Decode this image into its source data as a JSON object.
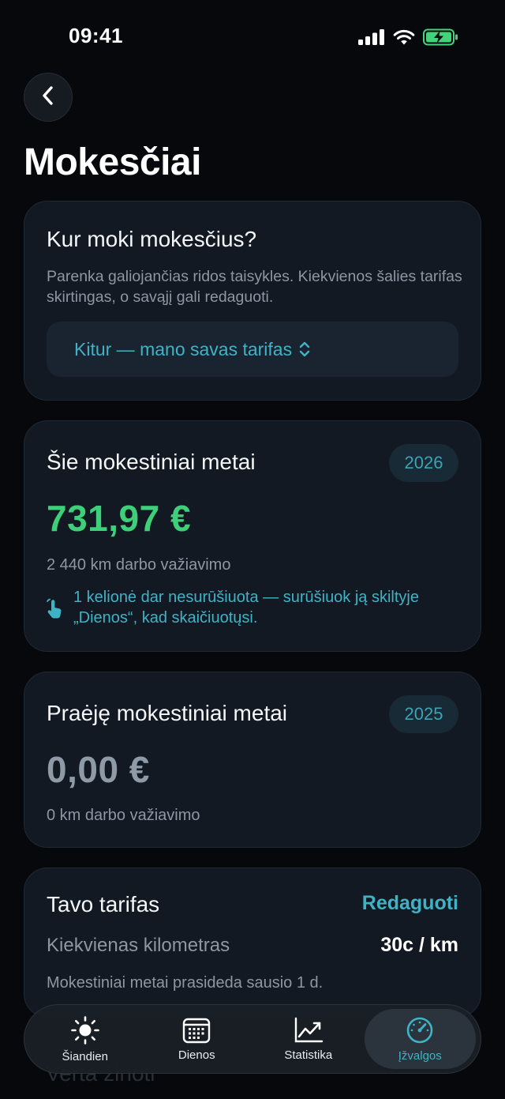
{
  "status_bar": {
    "time": "09:41"
  },
  "header": {
    "title": "Mokesčiai"
  },
  "country_card": {
    "title": "Kur moki mokesčius?",
    "description": "Parenka galiojančias ridos taisykles. Kiekvienos šalies tarifas skirtingas, o savąjį gali redaguoti.",
    "selected_option": "Kitur — mano savas tarifas"
  },
  "current_year_card": {
    "title": "Šie mokestiniai metai",
    "year": "2026",
    "amount": "731,97 €",
    "km_text": "2 440 km darbo važiavimo",
    "notice": "1 kelionė dar nesurūšiuota — surūšiuok ją skiltyje „Dienos“, kad skaičiuotųsi."
  },
  "previous_year_card": {
    "title": "Praėję mokestiniai metai",
    "year": "2025",
    "amount": "0,00 €",
    "km_text": "0 km darbo važiavimo"
  },
  "tariff_card": {
    "title": "Tavo tarifas",
    "edit_label": "Redaguoti",
    "rate_label": "Kiekvienas kilometras",
    "rate_value": "30c / km",
    "note": "Mokestiniai metai prasideda sausio 1 d."
  },
  "next_section": {
    "heading": "Verta žinoti"
  },
  "tabbar": {
    "tabs": [
      {
        "label": "Šiandien",
        "icon": "sun-icon"
      },
      {
        "label": "Dienos",
        "icon": "calendar-icon"
      },
      {
        "label": "Statistika",
        "icon": "chart-icon"
      },
      {
        "label": "Įžvalgos",
        "icon": "gauge-icon"
      }
    ],
    "active_index": 3
  },
  "colors": {
    "accent": "#3fb3c6",
    "positive_amount": "#3ecf7a",
    "zero_amount": "#8f9aa7",
    "battery": "#43d37a",
    "background": "#06080b",
    "card": "#121922"
  }
}
